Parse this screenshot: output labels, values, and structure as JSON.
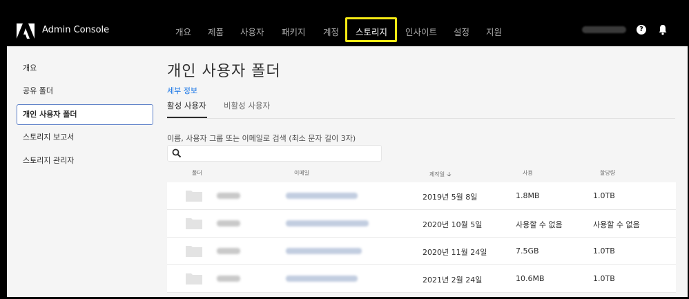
{
  "app": {
    "title": "Admin Console"
  },
  "nav": {
    "items": [
      {
        "label": "개요"
      },
      {
        "label": "제품"
      },
      {
        "label": "사용자"
      },
      {
        "label": "패키지"
      },
      {
        "label": "계정"
      },
      {
        "label": "스토리지",
        "active": true
      },
      {
        "label": "인사이트"
      },
      {
        "label": "설정"
      },
      {
        "label": "지원"
      }
    ]
  },
  "sidebar": {
    "items": [
      {
        "label": "개요"
      },
      {
        "label": "공유 폴더"
      },
      {
        "label": "개인 사용자 폴더",
        "active": true
      },
      {
        "label": "스토리지 보고서"
      },
      {
        "label": "스토리지 관리자"
      }
    ]
  },
  "main": {
    "title": "개인 사용자 폴더",
    "details_link": "세부 정보",
    "tabs": [
      {
        "label": "활성 사용자",
        "active": true
      },
      {
        "label": "비활성 사용자"
      }
    ],
    "search": {
      "label": "이름, 사용자 그룹 또는 이메일로 검색 (최소 문자 길이 3자)",
      "value": ""
    },
    "table": {
      "headers": {
        "folder": "폴더",
        "email": "이메일",
        "created": "제작일",
        "usage": "사용",
        "quota": "할당량"
      },
      "sort_icon": "arrow-down-icon",
      "rows": [
        {
          "created": "2019년 5월 8일",
          "usage": "1.8MB",
          "quota": "1.0TB"
        },
        {
          "created": "2020년 10월 5일",
          "usage": "사용할 수 없음",
          "quota": "사용할 수 없음"
        },
        {
          "created": "2020년 11월 24일",
          "usage": "7.5GB",
          "quota": "1.0TB"
        },
        {
          "created": "2021년 2월 24일",
          "usage": "10.6MB",
          "quota": "1.0TB"
        }
      ]
    }
  },
  "colors": {
    "accent": "#1473e6",
    "highlight": "#f5ea14",
    "topbar": "#000000"
  }
}
